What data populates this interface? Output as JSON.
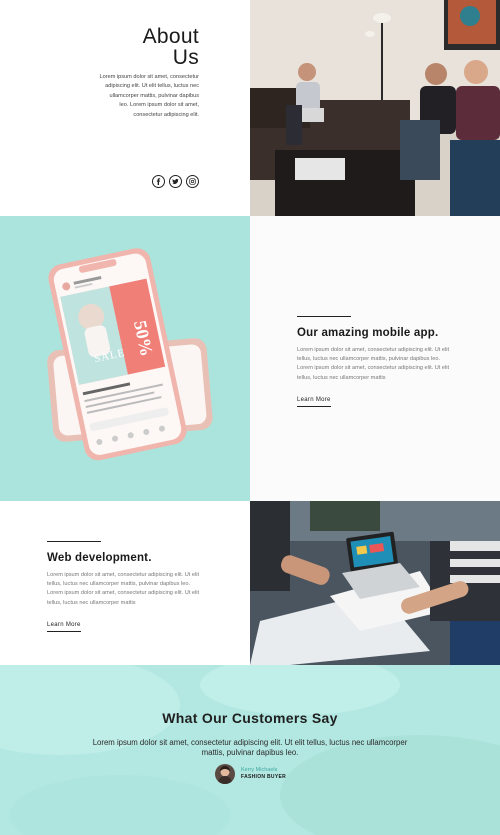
{
  "about": {
    "title_line1": "About",
    "title_line2": "Us",
    "body": "Lorem ipsum dolor sit amet, consectetur adipiscing elit. Ut elit tellus, luctus nec ullamcorper mattis, pulvinar dapibus leo. Lorem ipsum dolor sit amet, consectetur adipiscing elit.",
    "socials": [
      "facebook-icon",
      "twitter-icon",
      "instagram-icon"
    ]
  },
  "mobile_app": {
    "title": "Our amazing mobile app.",
    "body": "Lorem ipsum dolor sit amet, consectetur adipiscing elit. Ut elit tellus, luctus nec ullamcorper mattis, pulvinar dapibus leo. Lorem ipsum dolor sit amet, consectetur adipiscing elit. Ut elit tellus, luctus nec ullamcorper mattis",
    "link": "Learn More",
    "phone": {
      "sale_word": "SALE",
      "discount": "50%"
    }
  },
  "web_dev": {
    "title": "Web development.",
    "body": "Lorem ipsum dolor sit amet, consectetur adipiscing elit. Ut elit tellus, luctus nec ullamcorper mattis, pulvinar dapibus leo. Lorem ipsum dolor sit amet, consectetur adipiscing elit. Ut elit tellus, luctus nec ullamcorper mattis",
    "link": "Learn More"
  },
  "testimonials": {
    "title": "What Our Customers Say",
    "quote": "Lorem ipsum dolor sit amet, consectetur adipiscing elit. Ut elit tellus, luctus nec ullamcorper mattis, pulvinar dapibus leo.",
    "name": "Kerry Michaels",
    "role": "FASHION BUYER"
  },
  "colors": {
    "mint": "#abe4dc",
    "mint_light": "#b3e8e2",
    "accent_teal": "#3fa9a0",
    "phone_pink": "#f3b8b0",
    "text_dark": "#1a1a1a"
  }
}
